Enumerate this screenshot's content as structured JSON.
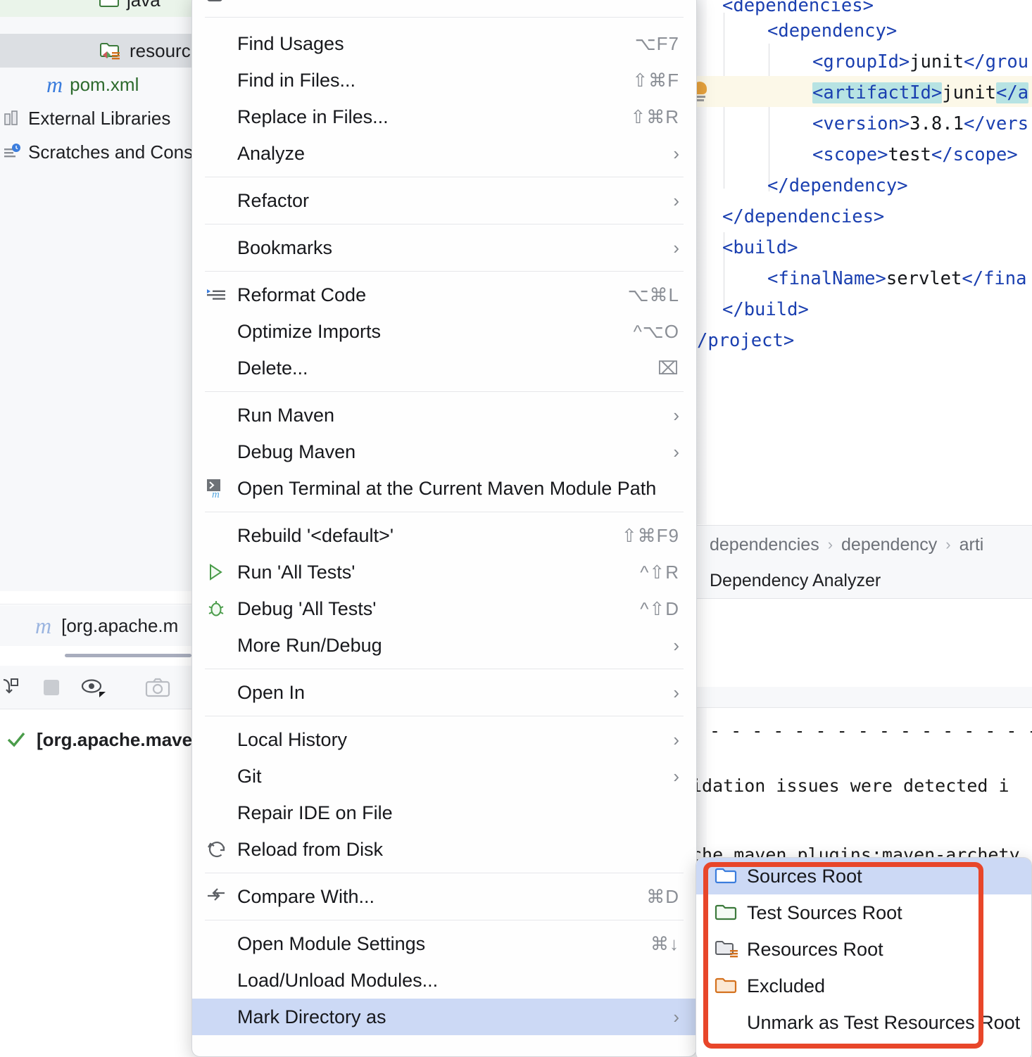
{
  "project_tree": {
    "items": [
      {
        "label": "java",
        "icon": "folder-green-icon",
        "state": "highlighted-green"
      },
      {
        "label": "resourc",
        "icon": "folder-resources-icon",
        "state": "selected"
      },
      {
        "label": "pom.xml",
        "icon": "maven-m-icon",
        "state": "normal"
      },
      {
        "label": "External Libraries",
        "icon": "library-icon",
        "state": "normal"
      },
      {
        "label": "Scratches and Cons",
        "icon": "scratches-icon",
        "state": "normal"
      }
    ]
  },
  "editor": {
    "lines": [
      {
        "text": "<dependencies>",
        "indent": 36
      },
      {
        "text": "<dependency>",
        "indent": 100
      },
      {
        "text": "<groupId>junit</grou",
        "indent": 164
      },
      {
        "text": "<artifactId>junit</a",
        "indent": 164
      },
      {
        "text": "<version>3.8.1</vers",
        "indent": 164
      },
      {
        "text": "<scope>test</scope>",
        "indent": 164
      },
      {
        "text": "</dependency>",
        "indent": 100
      },
      {
        "text": "</dependencies>",
        "indent": 36
      },
      {
        "text": "<build>",
        "indent": 36
      },
      {
        "text": "<finalName>servlet</fina",
        "indent": 100
      },
      {
        "text": "</build>",
        "indent": 36
      },
      {
        "text": "/project>",
        "indent": -8
      }
    ],
    "highlighted_line_index": 3,
    "gutter_icon": "lightbulb-intention-icon"
  },
  "breadcrumb": {
    "items": [
      "dependencies",
      "dependency",
      "arti"
    ],
    "separator": "›"
  },
  "tool_window": {
    "tab_label": "Dependency Analyzer"
  },
  "console": {
    "lines": [
      "- - - - - - - - - - - - - - - - - - - - - - - - - - -",
      "idation issues were detected i",
      "che.maven.plugins:maven-archety"
    ]
  },
  "run_panel": {
    "tab_label": "[org.apache.m",
    "tab_icon": "maven-m-icon",
    "result_label": "[org.apache.maver",
    "result_icon": "check-green-icon",
    "toolbar_buttons": [
      {
        "name": "rerun-failed-tests-icon"
      },
      {
        "name": "stop-icon"
      },
      {
        "name": "show-passed-eye-icon"
      },
      {
        "name": "export-snapshot-camera-icon"
      },
      {
        "name": "import-tests-icon"
      }
    ]
  },
  "context_menu": {
    "groups": [
      {
        "items": [
          {
            "label": "Find Usages",
            "shortcut": "⌥F7",
            "icon": null,
            "arrow": false
          },
          {
            "label": "Find in Files...",
            "shortcut": "⇧⌘F",
            "icon": null,
            "arrow": false
          },
          {
            "label": "Replace in Files...",
            "shortcut": "⇧⌘R",
            "icon": null,
            "arrow": false
          },
          {
            "label": "Analyze",
            "shortcut": "",
            "icon": null,
            "arrow": true
          }
        ]
      },
      {
        "items": [
          {
            "label": "Refactor",
            "shortcut": "",
            "icon": null,
            "arrow": true
          }
        ]
      },
      {
        "items": [
          {
            "label": "Bookmarks",
            "shortcut": "",
            "icon": null,
            "arrow": true
          }
        ]
      },
      {
        "items": [
          {
            "label": "Reformat Code",
            "shortcut": "⌥⌘L",
            "icon": "reformat-code-icon",
            "arrow": false
          },
          {
            "label": "Optimize Imports",
            "shortcut": "^⌥O",
            "icon": null,
            "arrow": false
          },
          {
            "label": "Delete...",
            "shortcut": "⌧",
            "icon": null,
            "arrow": false
          }
        ]
      },
      {
        "items": [
          {
            "label": "Run Maven",
            "shortcut": "",
            "icon": null,
            "arrow": true
          },
          {
            "label": "Debug Maven",
            "shortcut": "",
            "icon": null,
            "arrow": true
          },
          {
            "label": "Open Terminal at the Current Maven Module Path",
            "shortcut": "",
            "icon": "terminal-maven-icon",
            "arrow": false
          }
        ]
      },
      {
        "items": [
          {
            "label": "Rebuild '<default>'",
            "shortcut": "⇧⌘F9",
            "icon": null,
            "arrow": false
          },
          {
            "label": "Run 'All Tests'",
            "shortcut": "^⇧R",
            "icon": "run-play-icon",
            "arrow": false
          },
          {
            "label": "Debug 'All Tests'",
            "shortcut": "^⇧D",
            "icon": "debug-bug-icon",
            "arrow": false
          },
          {
            "label": "More Run/Debug",
            "shortcut": "",
            "icon": null,
            "arrow": true
          }
        ]
      },
      {
        "items": [
          {
            "label": "Open In",
            "shortcut": "",
            "icon": null,
            "arrow": true
          }
        ]
      },
      {
        "items": [
          {
            "label": "Local History",
            "shortcut": "",
            "icon": null,
            "arrow": true
          },
          {
            "label": "Git",
            "shortcut": "",
            "icon": null,
            "arrow": true
          },
          {
            "label": "Repair IDE on File",
            "shortcut": "",
            "icon": null,
            "arrow": false
          },
          {
            "label": "Reload from Disk",
            "shortcut": "",
            "icon": "reload-icon",
            "arrow": false
          }
        ]
      },
      {
        "items": [
          {
            "label": "Compare With...",
            "shortcut": "⌘D",
            "icon": "compare-icon",
            "arrow": false
          }
        ]
      },
      {
        "items": [
          {
            "label": "Open Module Settings",
            "shortcut": "⌘↓",
            "icon": null,
            "arrow": false
          },
          {
            "label": "Load/Unload Modules...",
            "shortcut": "",
            "icon": null,
            "arrow": false
          },
          {
            "label": "Mark Directory as",
            "shortcut": "",
            "icon": null,
            "arrow": true,
            "selected": true
          }
        ]
      }
    ]
  },
  "submenu": {
    "title": "Mark Directory as",
    "items": [
      {
        "label": "Sources Root",
        "icon": "folder-blue-icon",
        "selected": true
      },
      {
        "label": "Test Sources Root",
        "icon": "folder-green-icon",
        "selected": false
      },
      {
        "label": "Resources Root",
        "icon": "folder-resources-icon",
        "selected": false
      },
      {
        "label": "Excluded",
        "icon": "folder-orange-icon",
        "selected": false
      },
      {
        "label": "Unmark as Test Resources Root",
        "icon": null,
        "selected": false
      }
    ]
  },
  "annotation": {
    "highlight_color": "#e8462a",
    "shape": "rounded-rectangle"
  },
  "colors": {
    "selection_blue": "#ccd9f5",
    "menu_bg": "#fefefe",
    "xml_tag": "#1a3fb0",
    "highlight_token": "#b7e3e3",
    "current_line": "#fcf8e8"
  }
}
